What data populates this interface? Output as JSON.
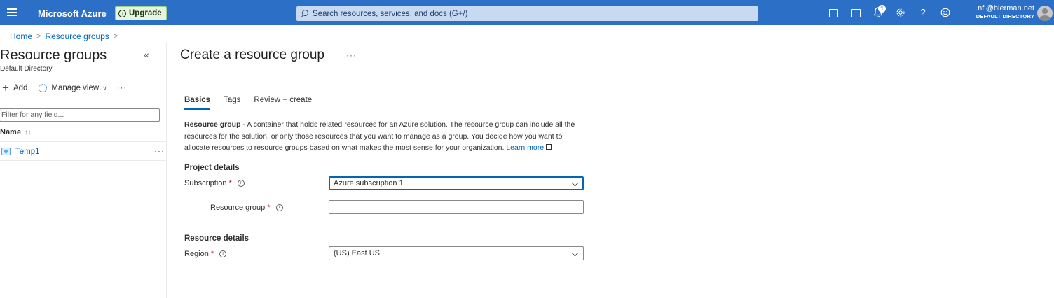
{
  "topbar": {
    "brand": "Microsoft Azure",
    "upgrade_label": "Upgrade",
    "search_placeholder": "Search resources, services, and docs (G+/)",
    "notification_count": "1",
    "account_email": "nfl@bierman.net",
    "account_directory": "DEFAULT DIRECTORY",
    "help_glyph": "?"
  },
  "breadcrumb": {
    "items": [
      "Home",
      "Resource groups"
    ],
    "sep": ">"
  },
  "left": {
    "title": "Resource groups",
    "subtitle": "Default Directory",
    "add_label": "Add",
    "manage_view_label": "Manage view",
    "filter_placeholder": "Filter for any field...",
    "name_header": "Name",
    "sort_glyph": "↑↓",
    "items": [
      {
        "name": "Temp1"
      }
    ]
  },
  "main": {
    "title": "Create a resource group",
    "tabs": [
      {
        "label": "Basics",
        "active": true
      },
      {
        "label": "Tags",
        "active": false
      },
      {
        "label": "Review + create",
        "active": false
      }
    ],
    "description_bold": "Resource group",
    "description_text": " - A container that holds related resources for an Azure solution. The resource group can include all the resources for the solution, or only those resources that you want to manage as a group. You decide how you want to allocate resources to resource groups based on what makes the most sense for your organization. ",
    "learn_more": "Learn more",
    "project_details": "Project details",
    "subscription_label": "Subscription",
    "subscription_value": "Azure subscription 1",
    "resource_group_label": "Resource group",
    "resource_group_value": "",
    "resource_details": "Resource details",
    "region_label": "Region",
    "region_value": "(US) East US",
    "required_marker": "*",
    "info_glyph": "i"
  },
  "colors": {
    "topbar": "#2c6fc6",
    "link": "#0067b8",
    "required": "#a4262c"
  },
  "icons": [
    "hamburger-icon",
    "upgrade-icon",
    "search-icon",
    "cloud-shell-icon",
    "directory-filter-icon",
    "notifications-icon",
    "settings-icon",
    "help-icon",
    "feedback-icon",
    "avatar",
    "collapse-icon",
    "add-icon",
    "gear-icon",
    "resource-group-icon",
    "external-link-icon",
    "info-icon",
    "chevron-down-icon"
  ]
}
